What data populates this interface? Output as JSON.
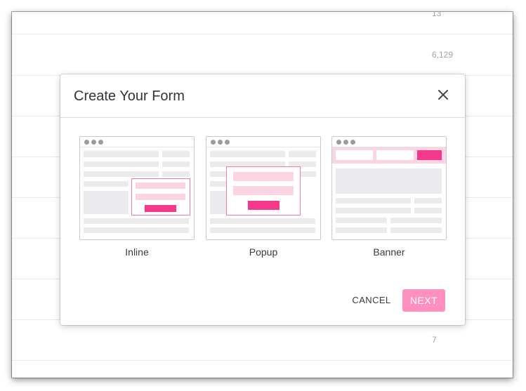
{
  "background_table": {
    "row_values": [
      "13",
      "6,129",
      "7"
    ]
  },
  "modal": {
    "title": "Create Your Form",
    "options": [
      {
        "label": "Inline"
      },
      {
        "label": "Popup"
      },
      {
        "label": "Banner"
      }
    ],
    "cancel_label": "CANCEL",
    "next_label": "NEXT"
  },
  "colors": {
    "accent": "#f5398a",
    "accent_light": "#fbd5e3",
    "next_button": "#ff8fbf"
  },
  "icons": {
    "close": "close-icon",
    "dots": "window-dots-icon"
  }
}
